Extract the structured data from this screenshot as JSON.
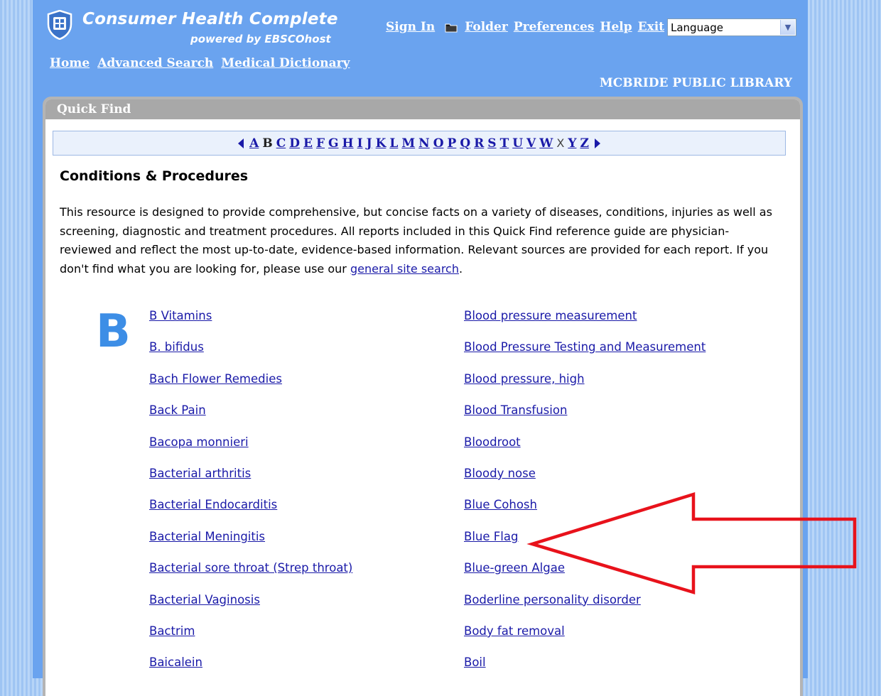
{
  "brand": {
    "title": "Consumer Health Complete",
    "subtitle": "powered by EBSCOhost"
  },
  "top_links": {
    "sign_in": "Sign In",
    "folder": "Folder",
    "preferences": "Preferences",
    "help": "Help",
    "exit": "Exit"
  },
  "language_select": {
    "selected": "Language"
  },
  "main_nav": {
    "home": "Home",
    "advanced_search": "Advanced Search",
    "medical_dictionary": "Medical Dictionary"
  },
  "library_name": "MCBRIDE PUBLIC LIBRARY",
  "panel": {
    "title": "Quick Find"
  },
  "alphabet": {
    "letters": [
      "A",
      "B",
      "C",
      "D",
      "E",
      "F",
      "G",
      "H",
      "I",
      "J",
      "K",
      "L",
      "M",
      "N",
      "O",
      "P",
      "Q",
      "R",
      "S",
      "T",
      "U",
      "V",
      "W",
      "X",
      "Y",
      "Z"
    ],
    "current": "B",
    "disabled": [
      "X"
    ]
  },
  "section": {
    "title": "Conditions & Procedures",
    "intro": "This resource is designed to provide comprehensive, but concise facts on a variety of diseases, conditions, injuries as well as screening, diagnostic and treatment procedures. All reports included in this Quick Find reference guide are physician-reviewed and reflect the most up-to-date, evidence-based information. Relevant sources are provided for each report. If you don't find what you are looking for, please use our ",
    "intro_link": "general site search",
    "intro_end": "."
  },
  "letter_heading": "B",
  "entries_left": [
    "B Vitamins",
    "B. bifidus",
    "Bach Flower Remedies",
    "Back Pain",
    "Bacopa monnieri",
    "Bacterial arthritis",
    "Bacterial Endocarditis",
    "Bacterial Meningitis",
    "Bacterial sore throat (Strep throat)",
    "Bacterial Vaginosis",
    "Bactrim",
    "Baicalein"
  ],
  "entries_right": [
    "Blood pressure measurement",
    "Blood Pressure Testing and Measurement",
    "Blood pressure, high",
    "Blood Transfusion",
    "Bloodroot",
    "Bloody nose",
    "Blue Cohosh",
    "Blue Flag",
    "Blue-green Algae",
    "Boderline personality disorder",
    "Body fat removal",
    "Boil"
  ],
  "colors": {
    "header_blue": "#6aa3ef",
    "link_blue": "#1a1aa8",
    "letter_blue": "#3d8ee6",
    "annotation_red": "#e8121b"
  }
}
